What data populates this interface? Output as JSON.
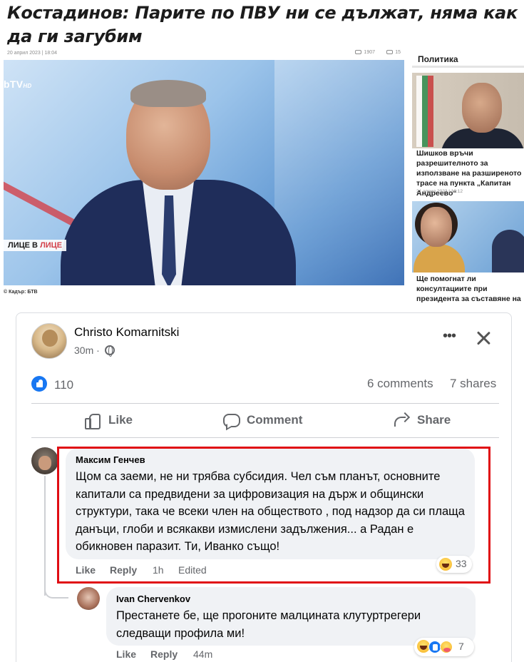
{
  "article": {
    "headline": "Костадинов: Парите по ПВУ ни се дължат, няма как да ги загубим",
    "date": "20 април 2023 | 18:04",
    "views": "1907",
    "comments": "15",
    "tv_logo": "bTV",
    "tv_logo_sub": "HD",
    "show_badge_a": "ЛИЦЕ В ",
    "show_badge_b": "ЛИЦЕ",
    "photo_credit": "© Кадър: БТВ"
  },
  "sidebar": {
    "title": "Политика",
    "items": [
      {
        "caption": "Шишков връчи разрешителното за използване на разширеното трасе на пункта „Капитан Андреево“",
        "date": "21 април 2023 | 13:12"
      },
      {
        "caption": "Ще помогнат ли консултациите при президента за съставяне на"
      }
    ]
  },
  "post": {
    "author": "Christo Komarnitski",
    "time": "30m ·",
    "likes": "110",
    "comments_label": "6 comments",
    "shares_label": "7 shares",
    "actions": {
      "like": "Like",
      "comment": "Comment",
      "share": "Share"
    }
  },
  "comments": [
    {
      "name": "Максим Генчев",
      "text": "Щом са заеми, не ни трябва субсидия. Чел съм планът, основните капитали са предвидени за цифровизация на държ и общински структури, така че всеки член на обществото , под надзор да си плаща данъци, глоби и всякакви измислени задължения... а Радан е обикновен паразит. Ти, Иванко също!",
      "like": "Like",
      "reply": "Reply",
      "time": "1h",
      "edited": "Edited",
      "reactions": "33"
    },
    {
      "name": "Ivan Chervenkov",
      "text": "Престанете бе, ще прогоните малцината клутуртрегери следващи профила ми!",
      "like": "Like",
      "reply": "Reply",
      "time": "44m",
      "reactions": "7"
    }
  ],
  "colors": {
    "fb_blue": "#1877f2",
    "highlight_red": "#e00d14",
    "bubble_bg": "#f0f2f5",
    "secondary_text": "#65676b"
  },
  "icons": [
    "views-icon",
    "comments-icon",
    "globe-icon",
    "more-icon",
    "close-icon",
    "like-reaction-icon",
    "thumbs-up-icon",
    "comment-icon",
    "share-icon",
    "laugh-reaction-icon",
    "care-reaction-icon"
  ]
}
